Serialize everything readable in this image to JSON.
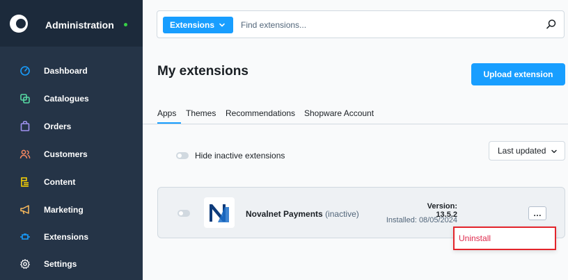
{
  "sidebar": {
    "title": "Administration",
    "items": [
      {
        "label": "Dashboard",
        "icon": "gauge-icon",
        "color": "#189eff"
      },
      {
        "label": "Catalogues",
        "icon": "tag-icon",
        "color": "#57d9a3"
      },
      {
        "label": "Orders",
        "icon": "shopping-bag-icon",
        "color": "#a092f0"
      },
      {
        "label": "Customers",
        "icon": "users-icon",
        "color": "#f88962"
      },
      {
        "label": "Content",
        "icon": "content-icon",
        "color": "#ffd700"
      },
      {
        "label": "Marketing",
        "icon": "megaphone-icon",
        "color": "#ffbd5d"
      },
      {
        "label": "Extensions",
        "icon": "plug-icon",
        "color": "#189eff"
      },
      {
        "label": "Settings",
        "icon": "gear-icon",
        "color": "#ffffff"
      }
    ]
  },
  "search": {
    "scope_label": "Extensions",
    "placeholder": "Find extensions..."
  },
  "page": {
    "title": "My extensions",
    "upload_label": "Upload extension"
  },
  "tabs": [
    {
      "label": "Apps",
      "active": true
    },
    {
      "label": "Themes",
      "active": false
    },
    {
      "label": "Recommendations",
      "active": false
    },
    {
      "label": "Shopware Account",
      "active": false
    }
  ],
  "filters": {
    "hide_inactive_label": "Hide inactive extensions",
    "sort_label": "Last updated"
  },
  "extension": {
    "name": "Novalnet Payments",
    "status": "(inactive)",
    "version": "Version: 13.5.2",
    "installed": "Installed: 08/05/2024",
    "more_label": "…"
  },
  "context_menu": {
    "items": [
      {
        "label": "Uninstall"
      }
    ]
  },
  "colors": {
    "accent": "#189eff",
    "sidebar_bg": "#253447",
    "danger": "#de294c",
    "online": "#37d046"
  }
}
